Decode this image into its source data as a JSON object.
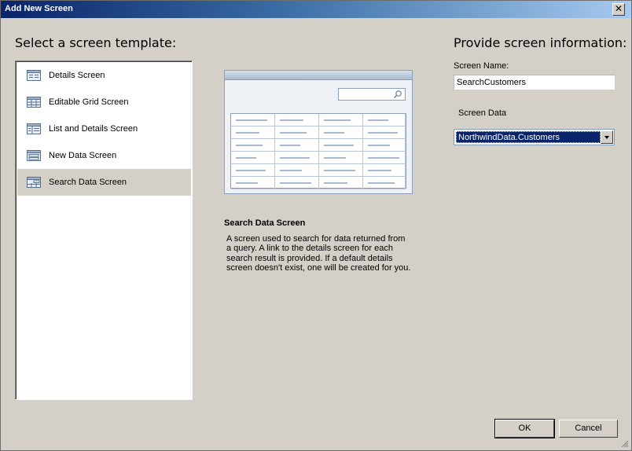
{
  "window": {
    "title": "Add New Screen",
    "close_glyph": "✕"
  },
  "left": {
    "heading": "Select a screen template:",
    "templates": [
      {
        "label": "Details Screen",
        "icon": "details-screen-icon"
      },
      {
        "label": "Editable Grid Screen",
        "icon": "editable-grid-icon"
      },
      {
        "label": "List and Details Screen",
        "icon": "list-details-icon"
      },
      {
        "label": "New Data Screen",
        "icon": "new-data-icon"
      },
      {
        "label": "Search Data Screen",
        "icon": "search-data-icon",
        "selected": true
      }
    ]
  },
  "preview": {
    "title": "Search Data Screen",
    "description": "A screen used to search for data returned from a query.  A link to the details screen for each search result is provided.  If a default details screen doesn't exist, one will be created for you."
  },
  "right": {
    "heading": "Provide screen information:",
    "screen_name_label": "Screen Name:",
    "screen_name_value": "SearchCustomers",
    "screen_data_label": "Screen Data",
    "screen_data_value": "NorthwindData.Customers"
  },
  "buttons": {
    "ok": "OK",
    "cancel": "Cancel"
  },
  "colors": {
    "selection": "#0a246a",
    "window_bg": "#d4d0c8"
  }
}
